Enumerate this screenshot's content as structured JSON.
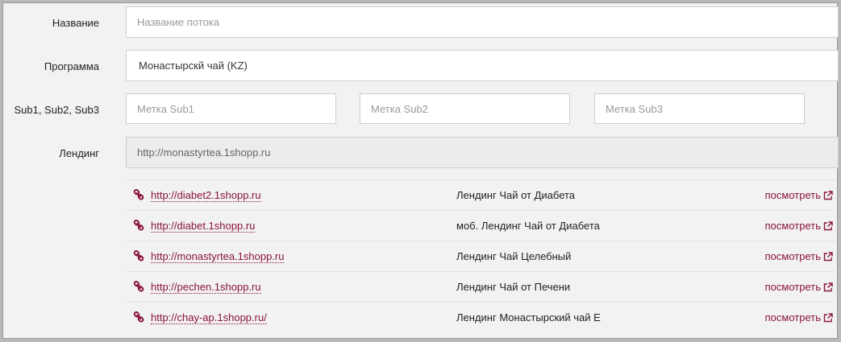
{
  "form": {
    "name_label": "Название",
    "name_placeholder": "Название потока",
    "program_label": "Программа",
    "program_value": "Монастырскй чай (KZ)",
    "subs_label": "Sub1, Sub2, Sub3",
    "sub1_placeholder": "Метка Sub1",
    "sub2_placeholder": "Метка Sub2",
    "sub3_placeholder": "Метка Sub3",
    "landing_label": "Лендинг",
    "landing_value": "http://monastyrtea.1shopp.ru"
  },
  "landings": [
    {
      "url": "http://diabet2.1shopp.ru",
      "name": "Лендинг Чай от Диабета",
      "view": "посмотреть"
    },
    {
      "url": "http://diabet.1shopp.ru",
      "name": "моб. Лендинг Чай от Диабета",
      "view": "посмотреть"
    },
    {
      "url": "http://monastyrtea.1shopp.ru",
      "name": "Лендинг Чай Целебный",
      "view": "посмотреть"
    },
    {
      "url": "http://pechen.1shopp.ru",
      "name": "Лендинг Чай от Печени",
      "view": "посмотреть"
    },
    {
      "url": "http://chay-ap.1shopp.ru/",
      "name": "Лендинг Монастырский чай Е",
      "view": "посмотреть"
    }
  ],
  "colors": {
    "accent": "#8a1538",
    "background": "#f2f2f2",
    "input_border": "#cfcfcf"
  },
  "icons": {
    "link": "link-icon",
    "external": "external-link-icon"
  }
}
